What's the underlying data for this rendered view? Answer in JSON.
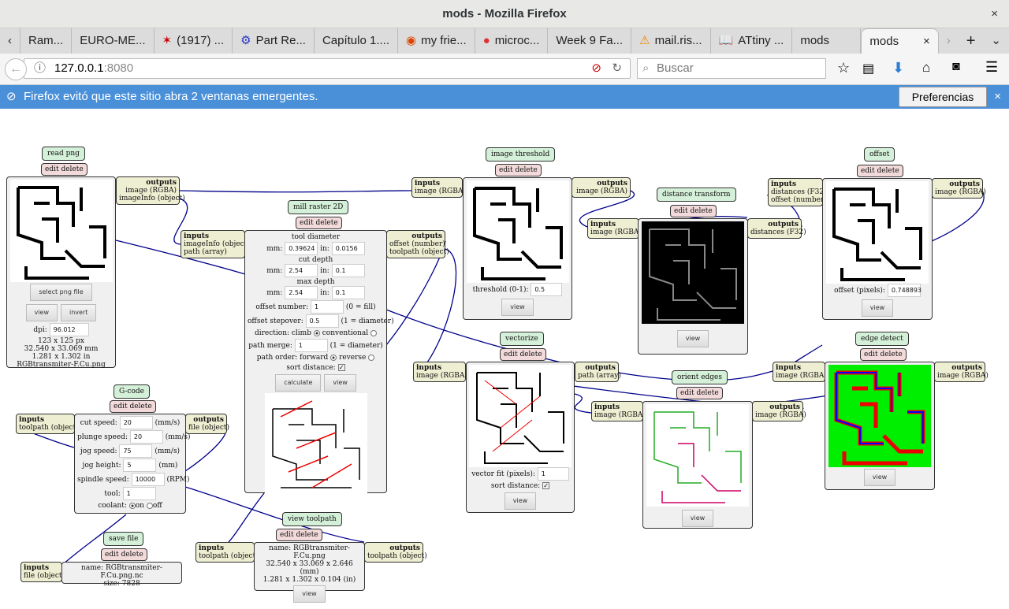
{
  "window": {
    "title": "mods - Mozilla Firefox",
    "close": "×"
  },
  "tabs": [
    {
      "label": "Ram..."
    },
    {
      "label": "EURO-ME..."
    },
    {
      "label": "(1917) ..."
    },
    {
      "label": "Part Re..."
    },
    {
      "label": "Capítulo 1...."
    },
    {
      "label": "my frie..."
    },
    {
      "label": "microc..."
    },
    {
      "label": "Week 9 Fa..."
    },
    {
      "label": "mail.ris..."
    },
    {
      "label": "ATtiny ..."
    },
    {
      "label": "mods"
    },
    {
      "label": "mods",
      "active": true
    }
  ],
  "nav": {
    "url_host": "127.0.0.1",
    "url_port": ":8080",
    "search_placeholder": "Buscar"
  },
  "notification": {
    "text": "Firefox evitó que este sitio abra 2 ventanas emergentes.",
    "button": "Preferencias",
    "close": "×"
  },
  "colors": {
    "wire": "#00008b",
    "notification": "#4a90d9",
    "module_title": "#d4f0d8",
    "edit_delete": "#f2dada",
    "io": "#eeeed2"
  },
  "ed": "edit delete",
  "in_h": "inputs",
  "out_h": "outputs",
  "view": "view",
  "read_png": {
    "title": "read png",
    "outputs": [
      "image (RGBA)",
      "imageInfo (object)"
    ],
    "select": "select png file",
    "invert": "invert",
    "dpi_label": "dpi:",
    "dpi": "96.012",
    "info": [
      "123 x 125 px",
      "32.540 x 33.069 mm",
      "1.281 x 1.302 in",
      "RGBtransmiter-F.Cu.png"
    ]
  },
  "mill": {
    "title": "mill raster 2D",
    "inputs": [
      "imageInfo (object)",
      "path (array)"
    ],
    "outputs": [
      "offset (number)",
      "toolpath (object)"
    ],
    "tool_diameter": "tool diameter",
    "cut_depth": "cut depth",
    "max_depth": "max depth",
    "mm": "mm:",
    "in": "in:",
    "td_mm": "0.39624",
    "td_in": "0.0156",
    "cd_mm": "2.54",
    "cd_in": "0.1",
    "md_mm": "2.54",
    "md_in": "0.1",
    "offset_number_label": "offset number:",
    "offset_number": "1",
    "offset_number_hint": "(0 = fill)",
    "stepover_label": "offset stepover:",
    "stepover": "0.5",
    "stepover_hint": "(1 = diameter)",
    "direction_label": "direction: climb",
    "conventional": "conventional",
    "direction": "climb",
    "merge_label": "path merge:",
    "merge": "1",
    "merge_hint": "(1 = diameter)",
    "order_label": "path order: forward",
    "reverse": "reverse",
    "order": "forward",
    "sort_label": "sort distance:",
    "sort": true,
    "calculate": "calculate"
  },
  "threshold": {
    "title": "image threshold",
    "inputs": [
      "image (RGBA)"
    ],
    "outputs": [
      "image (RGBA)"
    ],
    "label": "threshold (0-1):",
    "value": "0.5"
  },
  "distance": {
    "title": "distance transform",
    "inputs": [
      "image (RGBA)"
    ],
    "outputs": [
      "distances (F32)"
    ]
  },
  "offset": {
    "title": "offset",
    "inputs": [
      "distances (F32)",
      "offset (number)"
    ],
    "outputs": [
      "image (RGBA)"
    ],
    "label": "offset (pixels):",
    "value": "0.748893"
  },
  "vectorize": {
    "title": "vectorize",
    "inputs": [
      "image (RGBA)"
    ],
    "outputs": [
      "path (array)"
    ],
    "fit_label": "vector fit (pixels):",
    "fit": "1",
    "sort_label": "sort distance:",
    "sort": true
  },
  "orient": {
    "title": "orient edges",
    "inputs": [
      "image (RGBA)"
    ],
    "outputs": [
      "image (RGBA)"
    ]
  },
  "edge": {
    "title": "edge detect",
    "inputs": [
      "image (RGBA)"
    ],
    "outputs": [
      "image (RGBA)"
    ]
  },
  "gcode": {
    "title": "G-code",
    "inputs": [
      "toolpath (object)"
    ],
    "outputs": [
      "file (object)"
    ],
    "cut_label": "cut speed:",
    "cut": "20",
    "cut_u": "(mm/s)",
    "plunge_label": "plunge speed:",
    "plunge": "20",
    "plunge_u": "(mm/s)",
    "jog_label": "jog speed:",
    "jog": "75",
    "jog_u": "(mm/s)",
    "height_label": "jog height:",
    "height": "5",
    "height_u": "(mm)",
    "spindle_label": "spindle speed:",
    "spindle": "10000",
    "spindle_u": "(RPM)",
    "tool_label": "tool:",
    "tool": "1",
    "coolant_label": "coolant:",
    "on": "on",
    "off": "off",
    "coolant": "on"
  },
  "save": {
    "title": "save file",
    "inputs": [
      "file (object)"
    ],
    "name": "name: RGBtransmiter-F.Cu.png.nc",
    "size": "size: 7828"
  },
  "viewtp": {
    "title": "view toolpath",
    "inputs": [
      "toolpath (object)"
    ],
    "outputs": [
      "toolpath (object)"
    ],
    "info": [
      "name: RGBtransmiter-F.Cu.png",
      "32.540 x 33.069 x 2.646 (mm)",
      "1.281 x 1.302 x 0.104 (in)"
    ]
  }
}
